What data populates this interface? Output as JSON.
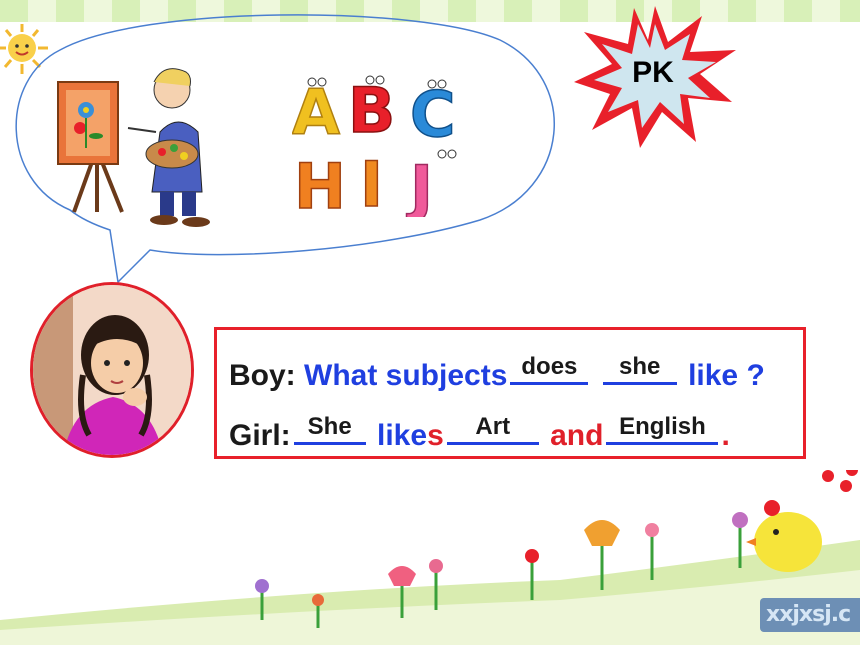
{
  "pk_label": "PK",
  "dialogue": {
    "boy": {
      "speaker": "Boy:",
      "question": "What subjects",
      "blank1": "does",
      "blank2": "she",
      "end": "like ?"
    },
    "girl": {
      "speaker": "Girl:",
      "blank1": "She",
      "verb_stem": "like",
      "verb_suffix": "s",
      "blank2": "Art",
      "conj_stem": "an",
      "conj_end": "d",
      "blank3": "English",
      "period": "."
    }
  },
  "watermark": "xxjxsj.c",
  "colors": {
    "accent_blue": "#1f3fe0",
    "accent_red": "#e0202a"
  }
}
